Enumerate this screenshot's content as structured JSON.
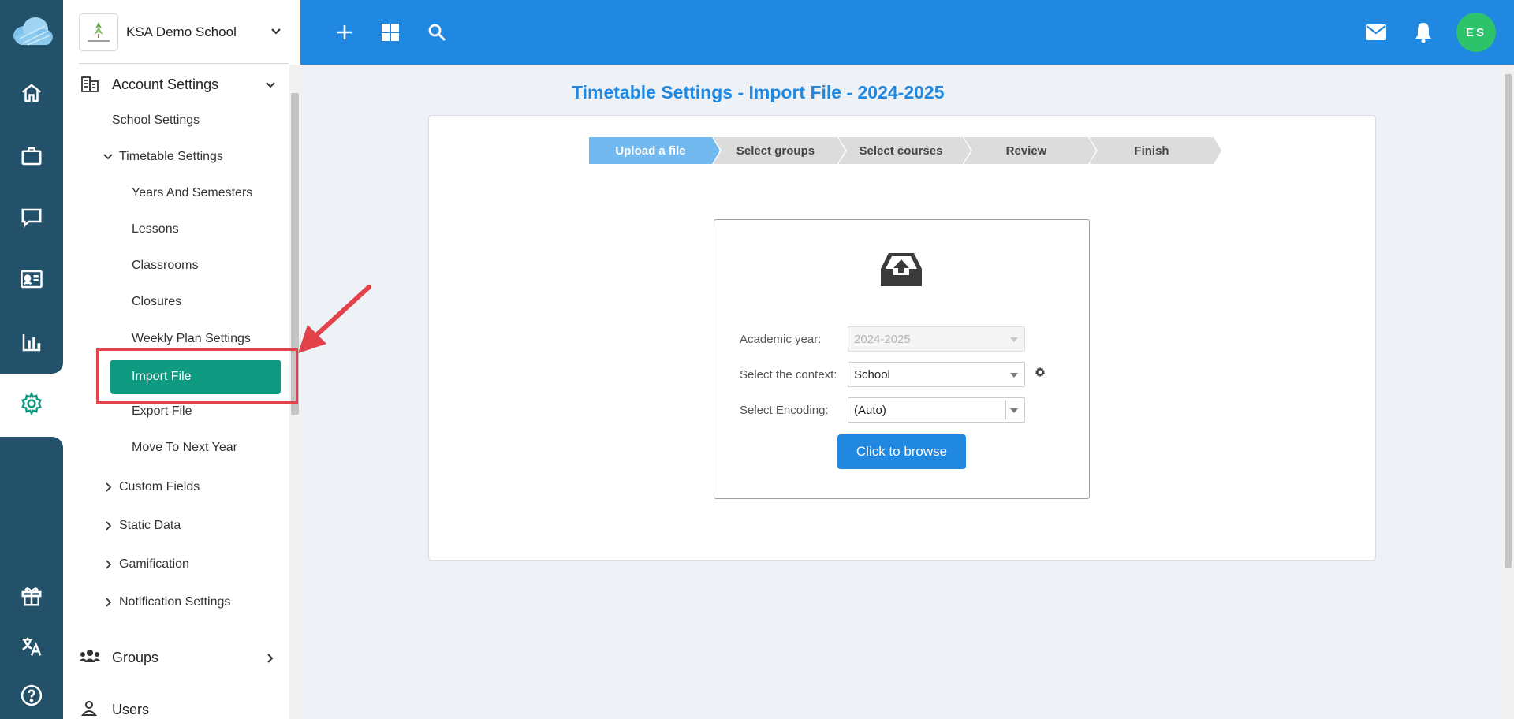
{
  "rail": {
    "icons": [
      "cloud-logo-icon",
      "home-icon",
      "briefcase-icon",
      "chat-icon",
      "id-card-icon",
      "bar-chart-icon",
      "gear-icon",
      "gift-icon",
      "translate-icon",
      "help-icon"
    ]
  },
  "sidebar": {
    "school_name": "KSA Demo School",
    "sections": {
      "account_settings": "Account Settings",
      "school_settings": "School Settings",
      "timetable_settings": "Timetable Settings",
      "timetable_items": [
        "Years And Semesters",
        "Lessons",
        "Classrooms",
        "Closures",
        "Weekly Plan Settings",
        "Import File",
        "Export File",
        "Move To Next Year"
      ],
      "custom_fields": "Custom Fields",
      "static_data": "Static Data",
      "gamification": "Gamification",
      "notification_settings": "Notification Settings",
      "groups": "Groups",
      "users": "Users"
    },
    "active_item": "Import File"
  },
  "topbar": {
    "icons": [
      "plus-icon",
      "grid-icon",
      "search-icon",
      "mail-icon",
      "bell-icon"
    ],
    "avatar_initials": "ES"
  },
  "main": {
    "title": "Timetable Settings - Import File - 2024-2025",
    "steps": [
      "Upload a file",
      "Select groups",
      "Select courses",
      "Review",
      "Finish"
    ],
    "active_step": "Upload a file",
    "form": {
      "academic_year_label": "Academic year:",
      "academic_year_value": "2024-2025",
      "context_label": "Select the context:",
      "context_value": "School",
      "encoding_label": "Select Encoding:",
      "encoding_value": "(Auto)",
      "browse_label": "Click to browse"
    }
  },
  "colors": {
    "rail_dark": "#24516a",
    "topbar": "#2088e0",
    "active_item": "#0f9a82",
    "active_step": "#71b9ee",
    "avatar": "#2cc36b",
    "annotation": "#e2424a"
  }
}
